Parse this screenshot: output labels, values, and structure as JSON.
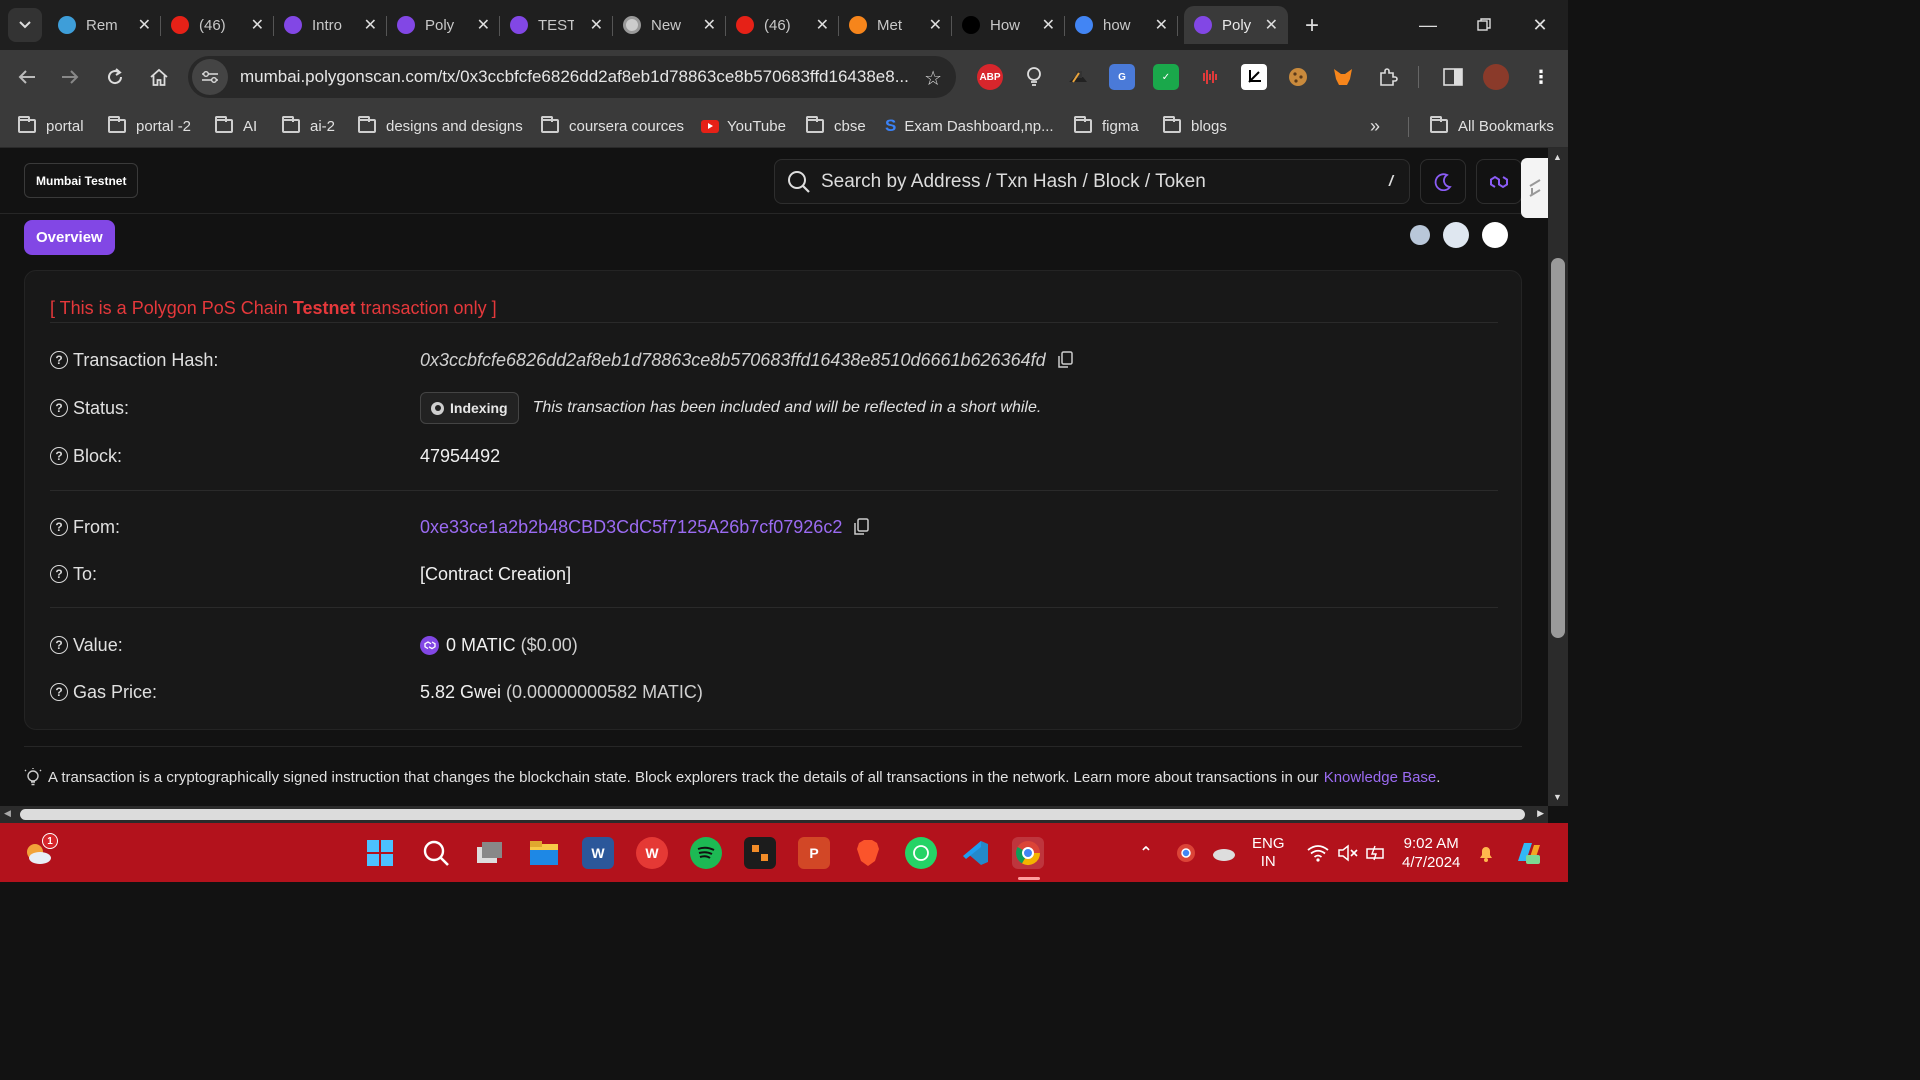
{
  "browser": {
    "tabs": [
      {
        "title": "Rem",
        "favicon": "remix-icon",
        "color": "#3e9ed9"
      },
      {
        "title": "(46)",
        "favicon": "youtube-icon",
        "color": "#e62117"
      },
      {
        "title": "Intro",
        "favicon": "polygon-icon",
        "color": "#8247e5"
      },
      {
        "title": "Poly",
        "favicon": "polygon-icon",
        "color": "#8247e5"
      },
      {
        "title": "TEST",
        "favicon": "polygon-icon",
        "color": "#8247e5"
      },
      {
        "title": "New",
        "favicon": "chrome-icon",
        "color": "#cccccc"
      },
      {
        "title": "(46)",
        "favicon": "youtube-icon",
        "color": "#e62117"
      },
      {
        "title": "Met",
        "favicon": "metamask-icon",
        "color": "#f6851b"
      },
      {
        "title": "How",
        "favicon": "medium-icon",
        "color": "#ffffff"
      },
      {
        "title": "how",
        "favicon": "google-icon",
        "color": "#4285f4"
      },
      {
        "title": "Poly",
        "favicon": "polygon-icon",
        "color": "#8247e5",
        "active": true
      }
    ],
    "url": "mumbai.polygonscan.com/tx/0x3ccbfcfe6826dd2af8eb1d78863ce8b570683ffd16438e8...",
    "extensions": [
      "ABP",
      "lightbulb",
      "hat",
      "translate",
      "check",
      "audio",
      "crop",
      "cookie",
      "metamask",
      "puzzle"
    ],
    "bookmarks": [
      {
        "label": "portal",
        "type": "folder"
      },
      {
        "label": "portal -2",
        "type": "folder"
      },
      {
        "label": "AI",
        "type": "folder"
      },
      {
        "label": "ai-2",
        "type": "folder"
      },
      {
        "label": "designs and designs",
        "type": "folder"
      },
      {
        "label": "coursera cources",
        "type": "folder"
      },
      {
        "label": "YouTube",
        "type": "youtube"
      },
      {
        "label": "cbse",
        "type": "folder"
      },
      {
        "label": "Exam Dashboard,np...",
        "type": "site"
      },
      {
        "label": "figma",
        "type": "folder"
      },
      {
        "label": "blogs",
        "type": "folder"
      }
    ],
    "all_bookmarks": "All Bookmarks",
    "overflow": "»"
  },
  "site": {
    "network": "Mumbai Testnet",
    "search_placeholder": "Search by Address / Txn Hash / Block / Token",
    "search_shortcut": "/",
    "overview_tab": "Overview",
    "accent": "#8247e5",
    "theme_dots": [
      "#b9c7d9",
      "#dfe7f0",
      "#ffffff"
    ]
  },
  "transaction": {
    "testnet_note_prefix": "[ This is a Polygon PoS Chain ",
    "testnet_note_bold": "Testnet",
    "testnet_note_suffix": " transaction only ]",
    "labels": {
      "hash": "Transaction Hash:",
      "status": "Status:",
      "block": "Block:",
      "from": "From:",
      "to": "To:",
      "value": "Value:",
      "gas": "Gas Price:"
    },
    "hash": "0x3ccbfcfe6826dd2af8eb1d78863ce8b570683ffd16438e8510d6661b626364fd",
    "status": "Indexing",
    "status_note": "This transaction has been included and will be reflected in a short while.",
    "block": "47954492",
    "from": "0xe33ce1a2b2b48CBD3CdC5f7125A26b7cf07926c2",
    "to": "[Contract Creation]",
    "value": "0 MATIC",
    "value_usd": "($0.00)",
    "gas_price": "5.82 Gwei",
    "gas_price_matic": "(0.00000000582 MATIC)"
  },
  "footer": {
    "text": "A transaction is a cryptographically signed instruction that changes the blockchain state. Block explorers track the details of all transactions in the network. Learn more about transactions in our",
    "link": "Knowledge Base",
    "end": "."
  },
  "taskbar": {
    "weather_badge": "1",
    "lang_line1": "ENG",
    "lang_line2": "IN",
    "time": "9:02 AM",
    "date": "4/7/2024"
  }
}
